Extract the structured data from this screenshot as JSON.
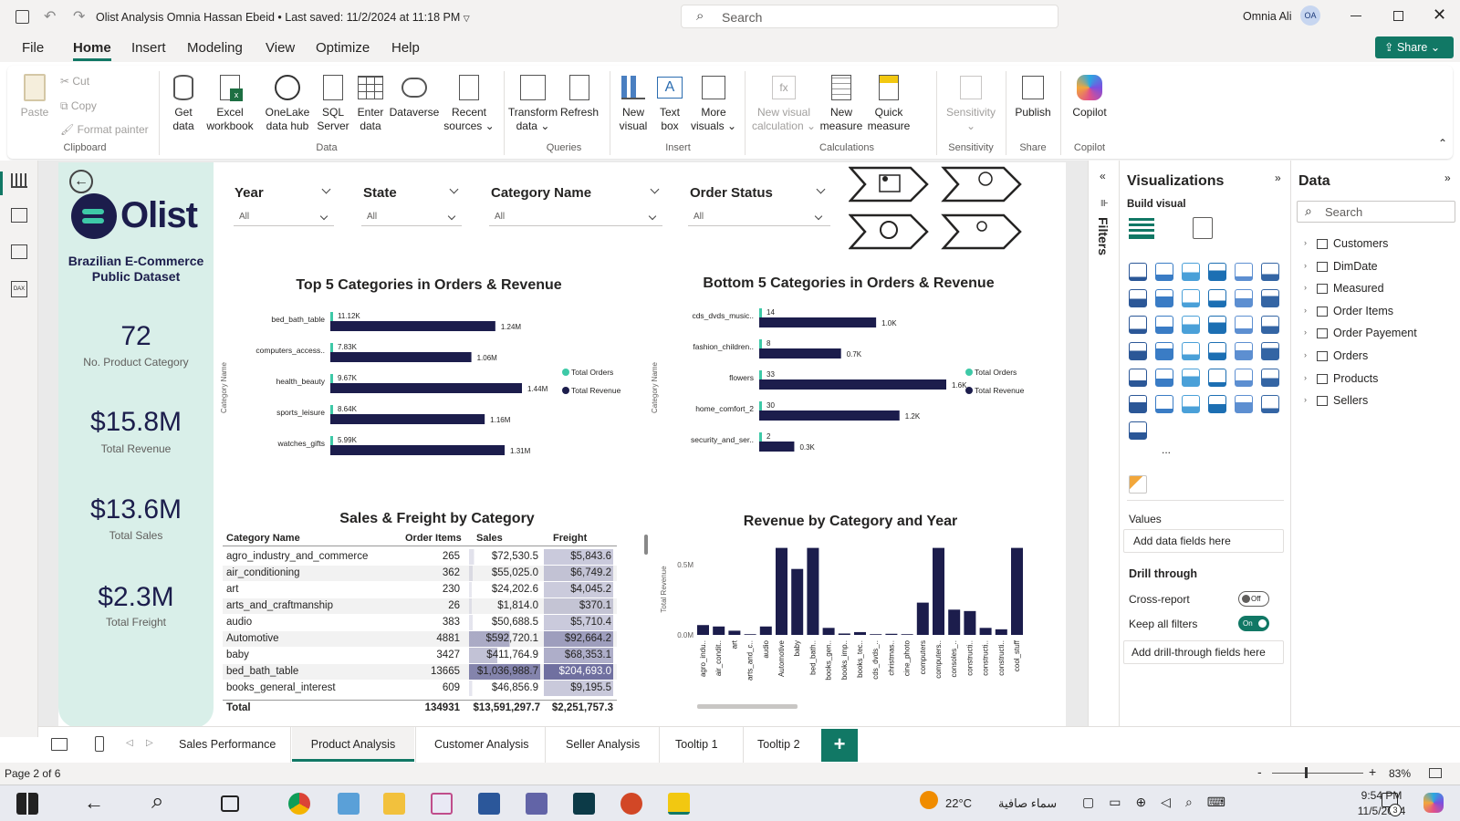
{
  "window": {
    "title": "Olist Analysis Omnia Hassan Ebeid",
    "saved": "Last saved: 11/2/2024 at 11:18 PM",
    "search_placeholder": "Search",
    "user": "Omnia Ali",
    "avatar": "OA",
    "share": "Share"
  },
  "menu": [
    "File",
    "Home",
    "Insert",
    "Modeling",
    "View",
    "Optimize",
    "Help"
  ],
  "ribbon": {
    "clipboard": {
      "paste": "Paste",
      "cut": "Cut",
      "copy": "Copy",
      "format_painter": "Format painter",
      "group": "Clipboard"
    },
    "data": {
      "get_data": [
        "Get",
        "data"
      ],
      "excel": [
        "Excel",
        "workbook"
      ],
      "onelake": [
        "OneLake",
        "data hub"
      ],
      "sql": [
        "SQL",
        "Server"
      ],
      "enter": [
        "Enter",
        "data"
      ],
      "dataverse": "Dataverse",
      "recent": [
        "Recent",
        "sources"
      ],
      "group": "Data"
    },
    "queries": {
      "transform": [
        "Transform",
        "data"
      ],
      "refresh": "Refresh",
      "group": "Queries"
    },
    "insert": {
      "new_visual": [
        "New",
        "visual"
      ],
      "text_box": [
        "Text",
        "box"
      ],
      "more": [
        "More",
        "visuals"
      ],
      "group": "Insert"
    },
    "calculations": {
      "new_calc": [
        "New visual",
        "calculation"
      ],
      "new_measure": [
        "New",
        "measure"
      ],
      "quick": [
        "Quick",
        "measure"
      ],
      "group": "Calculations"
    },
    "sensitivity": {
      "label": "Sensitivity",
      "group": "Sensitivity"
    },
    "share": {
      "publish": "Publish",
      "group": "Share"
    },
    "copilot": {
      "label": "Copilot",
      "group": "Copilot"
    }
  },
  "sidecard": {
    "subtitle": "Brazilian E-Commerce Public Dataset",
    "logo": "Olist",
    "kpis": [
      {
        "value": "72",
        "label": "No. Product Category"
      },
      {
        "value": "$15.8M",
        "label": "Total Revenue"
      },
      {
        "value": "$13.6M",
        "label": "Total Sales"
      },
      {
        "value": "$2.3M",
        "label": "Total Freight"
      }
    ]
  },
  "slicers": [
    {
      "title": "Year",
      "value": "All"
    },
    {
      "title": "State",
      "value": "All"
    },
    {
      "title": "Category Name",
      "value": "All"
    },
    {
      "title": "Order Status",
      "value": "All"
    }
  ],
  "top5": {
    "title": "Top 5 Categories in Orders & Revenue",
    "ylabel": "Category Name",
    "legend": [
      "Total Orders",
      "Total Revenue"
    ],
    "categories": [
      "bed_bath_table",
      "computers_access..",
      "health_beauty",
      "sports_leisure",
      "watches_gifts"
    ],
    "orders": [
      11.12,
      7.83,
      9.67,
      8.64,
      5.99
    ],
    "orders_labels": [
      "11.12K",
      "7.83K",
      "9.67K",
      "8.64K",
      "5.99K"
    ],
    "revenue": [
      1.24,
      1.06,
      1.44,
      1.16,
      1.31
    ],
    "revenue_labels": [
      "1.24M",
      "1.06M",
      "1.44M",
      "1.16M",
      "1.31M"
    ]
  },
  "bottom5": {
    "title": "Bottom 5 Categories in Orders & Revenue",
    "ylabel": "Category Name",
    "legend": [
      "Total Orders",
      "Total Revenue"
    ],
    "categories": [
      "cds_dvds_music..",
      "fashion_children..",
      "flowers",
      "home_comfort_2",
      "security_and_ser.."
    ],
    "orders": [
      14,
      8,
      33,
      30,
      2
    ],
    "orders_labels": [
      "14",
      "8",
      "33",
      "30",
      "2"
    ],
    "revenue": [
      1.0,
      0.7,
      1.6,
      1.2,
      0.3
    ],
    "revenue_labels": [
      "1.0K",
      "0.7K",
      "1.6K",
      "1.2K",
      "0.3K"
    ]
  },
  "table": {
    "title": "Sales & Freight by Category",
    "headers": [
      "Category Name",
      "Order Items",
      "Sales",
      "Freight"
    ],
    "rows": [
      [
        "agro_industry_and_commerce",
        "265",
        "$72,530.5",
        "$5,843.6"
      ],
      [
        "air_conditioning",
        "362",
        "$55,025.0",
        "$6,749.2"
      ],
      [
        "art",
        "230",
        "$24,202.6",
        "$4,045.2"
      ],
      [
        "arts_and_craftmanship",
        "26",
        "$1,814.0",
        "$370.1"
      ],
      [
        "audio",
        "383",
        "$50,688.5",
        "$5,710.4"
      ],
      [
        "Automotive",
        "4881",
        "$592,720.1",
        "$92,664.2"
      ],
      [
        "baby",
        "3427",
        "$411,764.9",
        "$68,353.1"
      ],
      [
        "bed_bath_table",
        "13665",
        "$1,036,988.7",
        "$204,693.0"
      ],
      [
        "books_general_interest",
        "609",
        "$46,856.9",
        "$9,195.5"
      ]
    ],
    "sales_values": [
      72530.5,
      55025.0,
      24202.6,
      1814.0,
      50688.5,
      592720.1,
      411764.9,
      1036988.7,
      46856.9
    ],
    "freight_values": [
      5843.6,
      6749.2,
      4045.2,
      370.1,
      5710.4,
      92664.2,
      68353.1,
      204693.0,
      9195.5
    ],
    "total": [
      "Total",
      "134931",
      "$13,591,297.7",
      "$2,251,757.3"
    ]
  },
  "chart_data": {
    "type": "bar",
    "title": "Revenue by Category and Year",
    "ylabel": "Total Revenue",
    "yticks": [
      "0.5M",
      "0.0M"
    ],
    "ylim": [
      0,
      0.65
    ],
    "categories": [
      "agro_indu..",
      "air_condit..",
      "art",
      "arts_and_c..",
      "audio",
      "Automotive",
      "baby",
      "bed_bath..",
      "books_gen..",
      "books_imp..",
      "books_tec..",
      "cds_dvds_..",
      "christmas..",
      "cine_photo",
      "computers",
      "computers..",
      "consoles_..",
      "constructi..",
      "constructi..",
      "constructi..",
      "cool_stuff"
    ],
    "values": [
      0.07,
      0.06,
      0.03,
      0.005,
      0.06,
      0.62,
      0.47,
      0.62,
      0.05,
      0.01,
      0.02,
      0.005,
      0.008,
      0.005,
      0.23,
      0.62,
      0.18,
      0.17,
      0.05,
      0.04,
      0.62
    ]
  },
  "filters": {
    "label": "Filters"
  },
  "viz": {
    "title": "Visualizations",
    "build": "Build visual",
    "values": "Values",
    "add_fields": "Add data fields here",
    "drill": "Drill through",
    "cross": "Cross-report",
    "cross_state": "Off",
    "keep": "Keep all filters",
    "keep_state": "On",
    "add_drill": "Add drill-through fields here",
    "more": "..."
  },
  "data": {
    "title": "Data",
    "search": "Search",
    "tables": [
      "Customers",
      "DimDate",
      "Measured",
      "Order Items",
      "Order Payement",
      "Orders",
      "Products",
      "Sellers"
    ]
  },
  "tabs": [
    "Sales Performance",
    "Product Analysis",
    "Customer Analysis",
    "Seller Analysis",
    "Tooltip 1",
    "Tooltip 2"
  ],
  "status": {
    "page": "Page 2 of 6",
    "zoom": "83%"
  },
  "taskbar": {
    "temp": "22°C",
    "weather": "سماء صافية",
    "time": "9:54 PM",
    "date": "11/5/2024",
    "notif": "3"
  },
  "colors": {
    "navy": "#1c1d4c",
    "mint": "#d9efe9",
    "teal": "#3ec9a7",
    "green": "#117865"
  }
}
